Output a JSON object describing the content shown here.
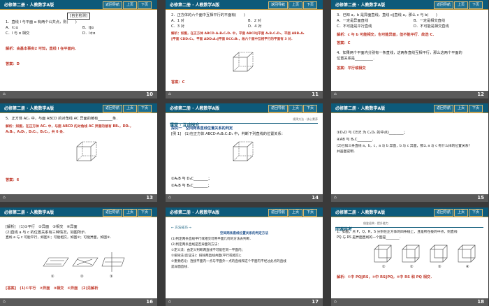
{
  "common": {
    "header_title": "必修第二册 · 人教数学A版",
    "nav_home": "返回导航",
    "nav_prev": "上页",
    "nav_next": "下页",
    "footer_symbol": "⌂"
  },
  "slides": [
    {
      "page": "10",
      "lines": [
        "[自主检测]",
        "1．直线 l 与平面 α 有两个公共点，则(　　)",
        "A．l⊂α",
        "B．l∥α",
        "C．l 与 α 相交",
        "D．l⊄α",
        "解析：由基本事实2 可知，直线 l 在平面内．",
        "答案：D"
      ]
    },
    {
      "page": "11",
      "lines": [
        "2．正方体的六个面中互相平行的平面有(　　)",
        "A．1 对",
        "B．2 对",
        "C．3 对",
        "D．4 对",
        "解析：如图，在正方体 ABCD-A₁B₁C₁D₁ 中，平面 ABCD∥平面 A₁B₁C₁D₁，平面 ABB₁A₁",
        "∥平面 CDD₁C₁，平面 ADD₁A₁∥平面 BCC₁B₁，故六个面中互相平行的平面有 3 对．",
        "答案：C"
      ]
    },
    {
      "page": "12",
      "lines": [
        "3．已知 a，b 是异面直线，直线 c∥直线 a，那么 c 与 b(　　)",
        "A．一定是异面直线",
        "B．一定是相交直线",
        "C．不可能是平行直线",
        "D．不可能是相交直线",
        "解析：c 与 b 可能相交，也可能异面，但不能平行．故选 C．",
        "答案：C",
        "4．如果两个平面内分别有一条直线，这两条直线互相平行，那么这两个平面的",
        "位置关系是__________．",
        "答案：平行或相交"
      ]
    },
    {
      "page": "13",
      "lines": [
        "5．正方体 AC₁ 中，与面 ABCD 的对角线 AC 异面的棱有________条．",
        "解析：如图，在正方体 AC₁ 中，与面 ABCD 的对角线 AC 异面的棱有 BB₁，DD₁，",
        "A₁B₁，A₁D₁，D₁C₁，B₁C₁，共 6 条．",
        "答案：6"
      ]
    },
    {
      "page": "14",
      "lines": [
        "课堂 · 互动探究",
        "规律方法 · 核心素养",
        "探究一　空间两条直线位置关系的判定",
        "[例 1]　(1)在正方体 ABCD-A₁B₁C₁D₁ 中，判断下列直线的位置关系：",
        "①A₁B 与 D₁C________；",
        "②A₁B 与 B₁C________；"
      ]
    },
    {
      "page": "15",
      "lines": [
        "③D₁D 与 CE(E 为 C₁D₁ 的中点)________；",
        "④AB 与 B₁C________．",
        "(2)已知三条直线 a，b，c，a 与 b 异面，b 与 c 异面，那么 a 与 c 有什么样的位置关系？",
        "并画图说明．"
      ]
    },
    {
      "page": "16",
      "lines": [
        "[解析]　(1)①平行　②异面　③相交　④异面",
        "(2)直线 a 与 c 的位置关系有三种情况，如图所示．",
        "直线 a 与 c 可能平行，如图①；可能相交，如图②；可能异面，如图③．",
        "①",
        "②",
        "③",
        "[答案]　(1)①平行　②异面　③相交　④异面　(2)见解析"
      ]
    },
    {
      "page": "17",
      "lines": [
        "← 方法技巧 →",
        "空间两条直线位置关系的判定方法",
        "(1)判定两条直线平行或相交可用平面几何的方法去判断．",
        "(2)判定两条直线是否异面的方法：",
        "①定义法：由定义判断两直线不可能在同一平面内；",
        "②排除法(反证法)：排除两直线共面(平行或相交)；",
        "③重要结论：连接平面内一点与平面外一点的直线和这个平面内不经过此点的直线",
        "是异面直线．"
      ]
    },
    {
      "page": "18",
      "lines": [
        "同源异考",
        "借鉴经典 · 提升能力",
        "1．如图，点 P，Q，R，S 分别在正方体的四条棱上，且是所在棱的中点，则直线",
        "PQ 与 RS 是异面直线的一个图是________．",
        "①",
        "②",
        "③",
        "④",
        "解析：①中 PQ∥RS，②中 RS∥PQ，④中 RS 和 PQ 相交．"
      ]
    }
  ]
}
